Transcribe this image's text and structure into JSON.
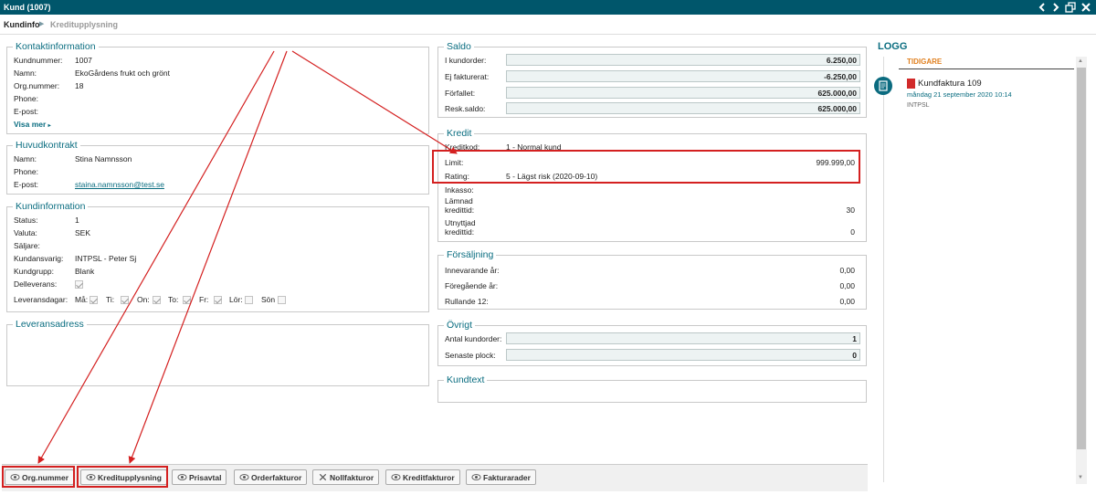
{
  "window": {
    "title": "Kund (1007)"
  },
  "breadcrumb": {
    "root": "Kundinfo",
    "current": "Kreditupplysning"
  },
  "kontakt": {
    "title": "Kontaktinformation",
    "kundnummer_label": "Kundnummer:",
    "kundnummer": "1007",
    "namn_label": "Namn:",
    "namn": "EkoGårdens frukt och grönt",
    "orgnr_label": "Org.nummer:",
    "orgnr": "18",
    "phone_label": "Phone:",
    "epost_label": "E-post:",
    "visa_mer": "Visa mer"
  },
  "huvud": {
    "title": "Huvudkontrakt",
    "namn_label": "Namn:",
    "namn": "Stina Namnsson",
    "phone_label": "Phone:",
    "epost_label": "E-post:",
    "epost": "staina.namnsson@test.se"
  },
  "kundinfo": {
    "title": "Kundinformation",
    "status_label": "Status:",
    "status": "1",
    "valuta_label": "Valuta:",
    "valuta": "SEK",
    "saljare_label": "Säljare:",
    "ansvarig_label": "Kundansvarig:",
    "ansvarig": "INTPSL - Peter Sj",
    "grupp_label": "Kundgrupp:",
    "grupp": "Blank",
    "delleverans_label": "Delleverans:",
    "leveransdagar_label": "Leveransdagar:",
    "days": [
      "Må:",
      "Ti:",
      "On:",
      "To:",
      "Fr:",
      "Lör:",
      "Sön"
    ]
  },
  "leverans": {
    "title": "Leveransadress"
  },
  "saldo": {
    "title": "Saldo",
    "rows": [
      {
        "label": "I kundorder:",
        "value": "6.250,00"
      },
      {
        "label": "Ej fakturerat:",
        "value": "-6.250,00"
      },
      {
        "label": "Förfallet:",
        "value": "625.000,00"
      },
      {
        "label": "Resk.saldo:",
        "value": "625.000,00"
      }
    ]
  },
  "kredit": {
    "title": "Kredit",
    "kreditkod_label": "Kreditkod:",
    "kreditkod": "1 - Normal kund",
    "limit_label": "Limit:",
    "limit": "999.999,00",
    "rating_label": "Rating:",
    "rating": "5 - Lägst risk (2020-09-10)",
    "inkasso_label": "Inkasso:",
    "lamnad_label1": "Lämnad",
    "lamnad_label2": "kredittid:",
    "lamnad": "30",
    "utnyttjad_label1": "Utnyttjad",
    "utnyttjad_label2": "kredittid:",
    "utnyttjad": "0"
  },
  "forsaljning": {
    "title": "Försäljning",
    "rows": [
      {
        "label": "Innevarande år:",
        "value": "0,00"
      },
      {
        "label": "Föregående år:",
        "value": "0,00"
      },
      {
        "label": "Rullande 12:",
        "value": "0,00"
      }
    ]
  },
  "ovrigt": {
    "title": "Övrigt",
    "rows": [
      {
        "label": "Antal kundorder:",
        "value": "1"
      },
      {
        "label": "Senaste plock:",
        "value": "0"
      }
    ]
  },
  "kundtext": {
    "title": "Kundtext"
  },
  "logg": {
    "title": "LOGG",
    "subtitle": "TIDIGARE",
    "item_title": "Kundfaktura 109",
    "item_date": "måndag 21 september 2020 10:14",
    "item_user": "INTPSL"
  },
  "footer": {
    "buttons": [
      "Org.nummer",
      "Kreditupplysning",
      "Prisavtal",
      "Orderfakturor",
      "Nollfakturor",
      "Kreditfakturor",
      "Fakturarader"
    ]
  },
  "colors": {
    "header": "#00566b",
    "accent": "#0a6d80",
    "annotation": "#d42020",
    "log_orange": "#e08020"
  }
}
